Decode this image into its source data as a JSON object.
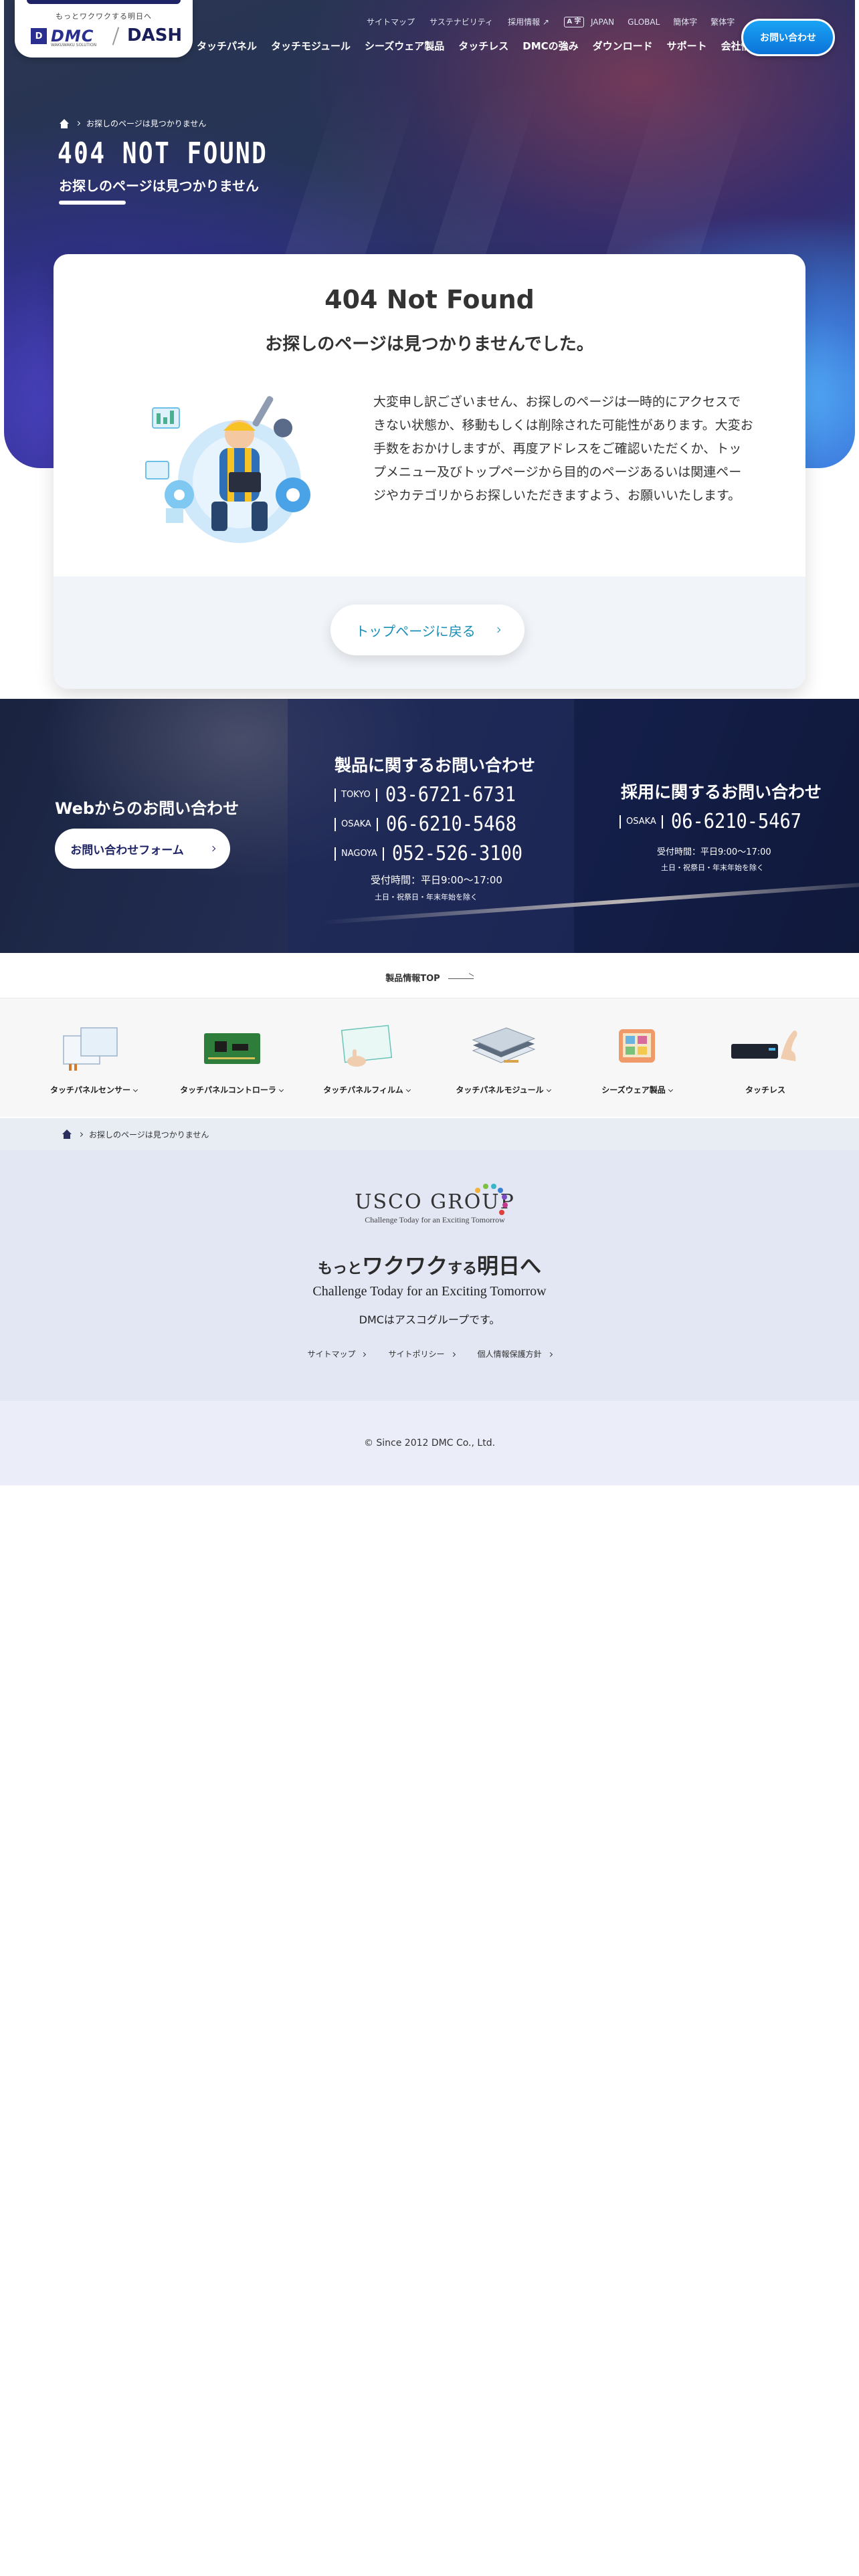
{
  "header": {
    "tagline": "もっとワクワクする明日へ",
    "logo_dmc": "DMC",
    "logo_dmc_sub": "WAKUWAKU SOLUTION",
    "logo_dash": "DASH",
    "utility_links": [
      "サイトマップ",
      "サステナビリティ",
      "採用情報 ↗"
    ],
    "lang_icon_text": "A 字",
    "lang_links": [
      "JAPAN",
      "GLOBAL",
      "簡体字",
      "繁体字"
    ],
    "nav": [
      "タッチパネル",
      "タッチモジュール",
      "シーズウェア製品",
      "タッチレス",
      "DMCの強み",
      "ダウンロード",
      "サポート",
      "会社情報"
    ],
    "contact_button": "お問い合わせ"
  },
  "hero": {
    "breadcrumb": "お探しのページは見つかりません",
    "title": "404 NOT FOUND",
    "subtitle": "お探しのページは見つかりません"
  },
  "card": {
    "title": "404 Not Found",
    "subtitle": "お探しのページは見つかりませんでした。",
    "message": "大変申し訳ございません、お探しのページは一時的にアクセスできない状態か、移動もしくは削除された可能性があります。大変お手数をおかけしますが、再度アドレスをご確認いただくか、トップメニュー及びトップページから目的のページあるいは関連ページやカテゴリからお探しいただきますよう、お願いいたします。",
    "button": "トップページに戻る"
  },
  "contact": {
    "web_title": "Webからのお問い合わせ",
    "web_button": "お問い合わせフォーム",
    "product_title": "製品に関するお問い合わせ",
    "product_phones": [
      {
        "city": "TOKYO",
        "number": "03-6721-6731"
      },
      {
        "city": "OSAKA",
        "number": "06-6210-5468"
      },
      {
        "city": "NAGOYA",
        "number": "052-526-3100"
      }
    ],
    "product_hours": "受付時間：平日9:00〜17:00",
    "product_note": "土日・祝祭日・年末年始を除く",
    "recruit_title": "採用に関するお問い合わせ",
    "recruit_phone": {
      "city": "OSAKA",
      "number": "06-6210-5467"
    },
    "recruit_hours": "受付時間：平日9:00〜17:00",
    "recruit_note": "土日・祝祭日・年末年始を除く"
  },
  "products": {
    "top_link": "製品情報TOP",
    "items": [
      "タッチパネルセンサー",
      "タッチパネルコントローラ",
      "タッチパネルフィルム",
      "タッチパネルモジュール",
      "シーズウェア製品",
      "タッチレス"
    ]
  },
  "breadcrumb2": "お探しのページは見つかりません",
  "footer": {
    "group_name": "USCO GROUP",
    "group_tagline": "Challenge Today for an Exciting Tomorrow",
    "slogan_jp_1": "もっと",
    "slogan_jp_2": "ワクワク",
    "slogan_jp_3": "する",
    "slogan_jp_4": "明日へ",
    "slogan_en": "Challenge Today for an Exciting Tomorrow",
    "member": "DMCはアスコグループです。",
    "links": [
      "サイトマップ",
      "サイトポリシー",
      "個人情報保護方針"
    ],
    "copyright": "© Since 2012 DMC Co., Ltd."
  }
}
